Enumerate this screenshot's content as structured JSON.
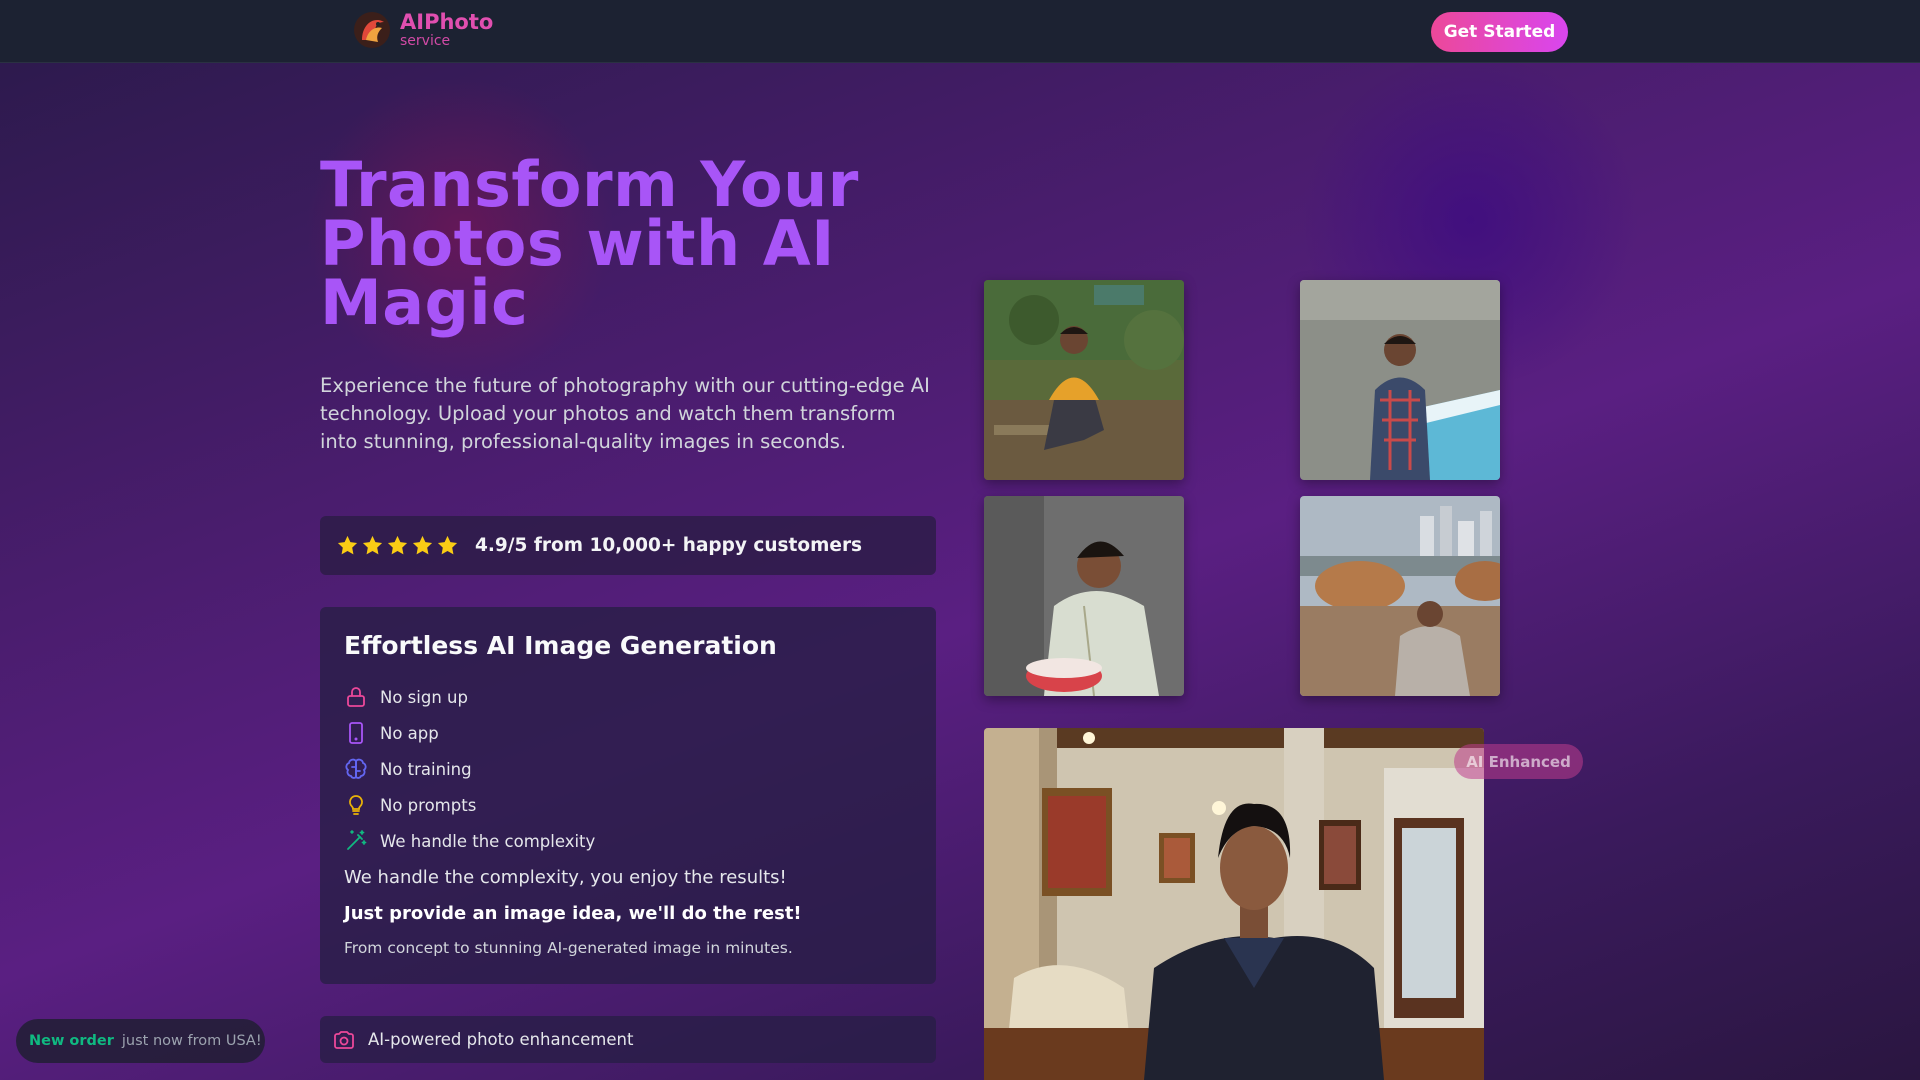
{
  "brand": {
    "name": "AIPhoto",
    "tagline": "service"
  },
  "header": {
    "cta_label": "Get Started"
  },
  "hero": {
    "title": "Transform Your Photos with AI Magic",
    "description": "Experience the future of photography with our cutting-edge AI technology. Upload your photos and watch them transform into stunning, professional-quality images in seconds."
  },
  "rating": {
    "stars": 5,
    "text": "4.9/5 from 10,000+ happy customers"
  },
  "features": {
    "title": "Effortless AI Image Generation",
    "items": [
      {
        "label": "No sign up",
        "icon": "lock-icon",
        "color": "#ec4899"
      },
      {
        "label": "No app",
        "icon": "phone-icon",
        "color": "#a855f7"
      },
      {
        "label": "No training",
        "icon": "brain-icon",
        "color": "#6366f1"
      },
      {
        "label": "No prompts",
        "icon": "lightbulb-icon",
        "color": "#eab308"
      },
      {
        "label": "We handle the complexity",
        "icon": "magic-wand-icon",
        "color": "#10b981"
      }
    ],
    "p1": "We handle the complexity, you enjoy the results!",
    "p2": "Just provide an image idea, we'll do the rest!",
    "p3": "From concept to stunning AI-generated image in minutes."
  },
  "enhancement": {
    "label": "AI-powered photo enhancement",
    "icon": "camera-icon"
  },
  "toast": {
    "strong": "New order",
    "rest": "just now from USA!"
  },
  "gallery": {
    "badge": "AI Enhanced"
  },
  "colors": {
    "accent_pink": "#ec4899",
    "accent_purple": "#a855f7",
    "header_bg": "#1c2232"
  }
}
